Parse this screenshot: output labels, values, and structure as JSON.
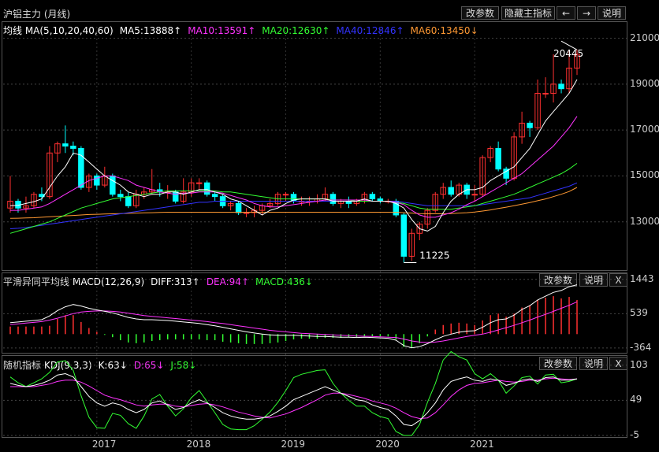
{
  "header": {
    "title": "沪铝主力 (月线)",
    "buttons": [
      "改参数",
      "隐藏主指标",
      "←",
      "→",
      "说明"
    ]
  },
  "ma_legend": [
    {
      "label": "均线 MA(5,10,20,40,60)",
      "color": "#ffffff"
    },
    {
      "label": "MA5:13888↑",
      "color": "#ffffff"
    },
    {
      "label": "MA10:13591↑",
      "color": "#ff33ff"
    },
    {
      "label": "MA20:12630↑",
      "color": "#33ff33"
    },
    {
      "label": "MA40:12846↑",
      "color": "#3333ff"
    },
    {
      "label": "MA60:13450↓",
      "color": "#ff9933"
    }
  ],
  "macd_panel": {
    "title": "平滑异同平均线",
    "legend": [
      {
        "label": "MACD(12,26,9)",
        "color": "#ffffff"
      },
      {
        "label": "DIFF:313↑",
        "color": "#ffffff"
      },
      {
        "label": "DEA:94↑",
        "color": "#ff33ff"
      },
      {
        "label": "MACD:436↓",
        "color": "#33ff33"
      }
    ],
    "buttons": [
      "改参数",
      "说明",
      "X"
    ],
    "yticks": [
      "1443",
      "539",
      "-364"
    ]
  },
  "kdj_panel": {
    "title": "随机指标",
    "legend": [
      {
        "label": "KDJ(9,3,3)",
        "color": "#ffffff"
      },
      {
        "label": "K:63↓",
        "color": "#ffffff"
      },
      {
        "label": "D:65↓",
        "color": "#ff33ff"
      },
      {
        "label": "J:58↓",
        "color": "#33ff33"
      }
    ],
    "buttons": [
      "改参数",
      "说明",
      "X"
    ],
    "yticks": [
      "103",
      "49",
      "-5"
    ]
  },
  "price_yticks": [
    "21000",
    "19000",
    "17000",
    "15000",
    "13000"
  ],
  "x_labels": [
    "2017",
    "2018",
    "2019",
    "2020",
    "2021"
  ],
  "annotations": {
    "high": "20445",
    "low": "11225"
  },
  "colors": {
    "up": "#ff3030",
    "down": "#00ffff",
    "ma5": "#ffffff",
    "ma10": "#ff33ff",
    "ma20": "#33ff33",
    "ma40": "#3333ff",
    "ma60": "#ff9933"
  },
  "chart_data": {
    "type": "candlestick",
    "price_range": [
      11000,
      21500
    ],
    "first_year": "2016",
    "candles": [
      [
        13600,
        13900,
        15000,
        13400
      ],
      [
        13900,
        13600,
        14000,
        13400
      ],
      [
        13600,
        13700,
        14100,
        13400
      ],
      [
        13700,
        14200,
        14300,
        13600
      ],
      [
        14200,
        14100,
        14500,
        13900
      ],
      [
        14100,
        16000,
        16300,
        14000
      ],
      [
        16000,
        16400,
        16500,
        15600
      ],
      [
        16400,
        16300,
        17200,
        16000
      ],
      [
        16300,
        16200,
        16500,
        15900
      ],
      [
        16200,
        14500,
        16300,
        14400
      ],
      [
        14500,
        15000,
        15100,
        14300
      ],
      [
        15000,
        14600,
        15100,
        14400
      ],
      [
        14600,
        15000,
        15400,
        14500
      ],
      [
        15000,
        14200,
        15100,
        14100
      ],
      [
        14200,
        14100,
        14400,
        13900
      ],
      [
        14100,
        13700,
        14300,
        13600
      ],
      [
        13700,
        14200,
        14400,
        13600
      ],
      [
        14200,
        14300,
        14500,
        14000
      ],
      [
        14300,
        14400,
        15300,
        14200
      ],
      [
        14400,
        14300,
        14700,
        14100
      ],
      [
        14300,
        14300,
        14600,
        14000
      ],
      [
        14300,
        13900,
        14400,
        13800
      ],
      [
        13900,
        14300,
        14900,
        13800
      ],
      [
        14300,
        14700,
        14900,
        14100
      ],
      [
        14700,
        14700,
        14900,
        14400
      ],
      [
        14700,
        14200,
        14800,
        14100
      ],
      [
        14200,
        14100,
        14300,
        13900
      ],
      [
        14100,
        13700,
        14200,
        13600
      ],
      [
        13700,
        13800,
        13900,
        13500
      ],
      [
        13800,
        13400,
        13900,
        13300
      ],
      [
        13400,
        13400,
        13600,
        13200
      ],
      [
        13400,
        13500,
        13700,
        13200
      ],
      [
        13500,
        13700,
        13800,
        13300
      ],
      [
        13700,
        13800,
        14000,
        13600
      ],
      [
        13800,
        14200,
        14300,
        13700
      ],
      [
        14200,
        14200,
        14300,
        13900
      ],
      [
        14200,
        13900,
        14300,
        13800
      ],
      [
        13900,
        13900,
        14100,
        13700
      ],
      [
        13900,
        13900,
        14100,
        13700
      ],
      [
        13900,
        14000,
        14200,
        13800
      ],
      [
        14000,
        14200,
        14500,
        13900
      ],
      [
        14200,
        13800,
        14300,
        13700
      ],
      [
        13800,
        13900,
        14000,
        13600
      ],
      [
        13900,
        13800,
        14100,
        13600
      ],
      [
        13800,
        13900,
        14000,
        13700
      ],
      [
        13900,
        14200,
        14300,
        13800
      ],
      [
        14200,
        14000,
        14300,
        13900
      ],
      [
        14000,
        13900,
        14100,
        13800
      ],
      [
        13900,
        13900,
        14000,
        13800
      ],
      [
        13900,
        13300,
        14000,
        13200
      ],
      [
        13300,
        11500,
        13400,
        11225
      ],
      [
        11500,
        12500,
        12700,
        11300
      ],
      [
        12500,
        12900,
        13000,
        12200
      ],
      [
        12900,
        13500,
        13600,
        12700
      ],
      [
        13500,
        14200,
        14300,
        13400
      ],
      [
        14200,
        14500,
        14700,
        14000
      ],
      [
        14500,
        14200,
        14800,
        14100
      ],
      [
        14200,
        14600,
        14700,
        14100
      ],
      [
        14600,
        14200,
        14700,
        14000
      ],
      [
        14200,
        14200,
        14600,
        13900
      ],
      [
        14200,
        15800,
        15900,
        14100
      ],
      [
        15800,
        16200,
        16300,
        15600
      ],
      [
        16200,
        15300,
        16500,
        15200
      ],
      [
        15300,
        14900,
        15400,
        14600
      ],
      [
        14900,
        16700,
        16900,
        14800
      ],
      [
        16700,
        17300,
        17800,
        16400
      ],
      [
        17300,
        17100,
        17400,
        16700
      ],
      [
        17100,
        18600,
        19200,
        17000
      ],
      [
        18600,
        18600,
        19300,
        18400
      ],
      [
        18600,
        19000,
        20300,
        18200
      ],
      [
        19000,
        18800,
        19200,
        18600
      ],
      [
        18800,
        19700,
        20445,
        18600
      ],
      [
        19700,
        20300,
        20500,
        19400
      ]
    ],
    "ma5": [
      13700,
      13720,
      13800,
      13880,
      14000,
      14500,
      15000,
      15400,
      16000,
      15900,
      15600,
      15300,
      15000,
      14800,
      14600,
      14300,
      14200,
      14100,
      14200,
      14200,
      14300,
      14300,
      14200,
      14300,
      14400,
      14400,
      14300,
      14200,
      14000,
      13900,
      13700,
      13500,
      13300,
      13500,
      13600,
      13800,
      13950,
      14000,
      14000,
      14000,
      14000,
      13900,
      13900,
      13900,
      13900,
      14000,
      13900,
      13900,
      13900,
      13800,
      13600,
      13100,
      12700,
      12600,
      12800,
      13400,
      13900,
      14200,
      14400,
      14400,
      14500,
      14800,
      15000,
      15200,
      15400,
      15800,
      16200,
      16800,
      17400,
      17800,
      18200,
      18600,
      19200
    ],
    "ma10": [
      13500,
      13500,
      13550,
      13600,
      13650,
      13800,
      14000,
      14200,
      14400,
      14600,
      14800,
      14900,
      15000,
      15000,
      14900,
      14800,
      14600,
      14500,
      14400,
      14300,
      14250,
      14200,
      14250,
      14250,
      14300,
      14300,
      14300,
      14250,
      14150,
      14050,
      13950,
      13800,
      13700,
      13650,
      13650,
      13700,
      13750,
      13800,
      13850,
      13900,
      13950,
      13950,
      13950,
      13950,
      13950,
      13950,
      13900,
      13900,
      13900,
      13850,
      13750,
      13500,
      13300,
      13200,
      13200,
      13300,
      13400,
      13550,
      13750,
      13900,
      14100,
      14300,
      14500,
      14700,
      14900,
      15100,
      15400,
      15700,
      16000,
      16300,
      16700,
      17100,
      17600
    ],
    "ma20": [
      12500,
      12600,
      12700,
      12800,
      12900,
      13000,
      13150,
      13300,
      13450,
      13600,
      13700,
      13800,
      13900,
      14000,
      14050,
      14100,
      14150,
      14200,
      14250,
      14300,
      14350,
      14350,
      14350,
      14350,
      14350,
      14350,
      14350,
      14300,
      14300,
      14250,
      14200,
      14150,
      14100,
      14050,
      14000,
      14000,
      14000,
      14000,
      14000,
      14000,
      14000,
      13950,
      13950,
      13950,
      13900,
      13900,
      13900,
      13900,
      13900,
      13850,
      13800,
      13700,
      13600,
      13550,
      13550,
      13550,
      13550,
      13600,
      13650,
      13700,
      13800,
      13900,
      14000,
      14100,
      14200,
      14350,
      14500,
      14650,
      14800,
      14950,
      15100,
      15300,
      15550
    ],
    "ma40": [
      12700,
      12720,
      12750,
      12800,
      12850,
      12900,
      12950,
      13000,
      13050,
      13100,
      13150,
      13200,
      13250,
      13300,
      13350,
      13400,
      13450,
      13500,
      13550,
      13600,
      13650,
      13700,
      13750,
      13800,
      13850,
      13850,
      13900,
      13900,
      13900,
      13900,
      13900,
      13900,
      13900,
      13900,
      13900,
      13900,
      13900,
      13900,
      13900,
      13900,
      13900,
      13900,
      13900,
      13900,
      13900,
      13900,
      13900,
      13900,
      13900,
      13900,
      13850,
      13800,
      13750,
      13700,
      13700,
      13700,
      13700,
      13700,
      13700,
      13700,
      13750,
      13800,
      13850,
      13900,
      13950,
      14000,
      14050,
      14150,
      14250,
      14350,
      14450,
      14550,
      14700
    ],
    "ma60": [
      13150,
      13160,
      13170,
      13180,
      13200,
      13220,
      13240,
      13260,
      13280,
      13300,
      13320,
      13330,
      13340,
      13350,
      13360,
      13370,
      13380,
      13390,
      13400,
      13410,
      13420,
      13420,
      13420,
      13420,
      13420,
      13420,
      13420,
      13420,
      13420,
      13420,
      13420,
      13420,
      13420,
      13420,
      13420,
      13420,
      13420,
      13420,
      13420,
      13420,
      13420,
      13420,
      13420,
      13420,
      13420,
      13420,
      13420,
      13420,
      13420,
      13420,
      13400,
      13380,
      13360,
      13350,
      13350,
      13350,
      13360,
      13380,
      13400,
      13430,
      13470,
      13520,
      13580,
      13640,
      13700,
      13770,
      13840,
      13920,
      14000,
      14100,
      14200,
      14320,
      14500
    ],
    "macd": {
      "range": [
        -450,
        1500
      ],
      "diff": [
        300,
        320,
        340,
        360,
        380,
        480,
        620,
        720,
        780,
        740,
        680,
        640,
        600,
        560,
        500,
        440,
        400,
        380,
        380,
        370,
        360,
        340,
        320,
        300,
        280,
        250,
        220,
        180,
        140,
        100,
        60,
        30,
        0,
        -20,
        -30,
        -30,
        -30,
        -40,
        -50,
        -60,
        -60,
        -70,
        -80,
        -80,
        -90,
        -80,
        -90,
        -100,
        -110,
        -160,
        -300,
        -360,
        -330,
        -250,
        -150,
        -60,
        0,
        50,
        80,
        90,
        180,
        300,
        380,
        400,
        500,
        650,
        750,
        900,
        1000,
        1100,
        1150,
        1250,
        1300
      ],
      "dea": [
        250,
        270,
        290,
        310,
        330,
        370,
        420,
        480,
        540,
        580,
        600,
        610,
        610,
        600,
        580,
        550,
        520,
        490,
        470,
        450,
        430,
        410,
        390,
        370,
        350,
        330,
        300,
        280,
        250,
        220,
        190,
        160,
        130,
        100,
        80,
        60,
        40,
        20,
        10,
        0,
        -10,
        -20,
        -30,
        -40,
        -50,
        -55,
        -60,
        -70,
        -80,
        -90,
        -130,
        -180,
        -210,
        -220,
        -210,
        -180,
        -140,
        -100,
        -60,
        -30,
        0,
        50,
        110,
        170,
        230,
        300,
        370,
        450,
        520,
        600,
        680,
        760,
        850
      ],
      "hist": [
        200,
        200,
        200,
        200,
        200,
        220,
        400,
        500,
        500,
        320,
        160,
        60,
        -20,
        -80,
        -160,
        -220,
        -240,
        -220,
        -180,
        -160,
        -140,
        -140,
        -140,
        -140,
        -140,
        -160,
        -160,
        -200,
        -220,
        -240,
        -260,
        -260,
        -260,
        -240,
        -220,
        -180,
        -140,
        -120,
        -120,
        -120,
        -100,
        -100,
        -100,
        -80,
        -80,
        -50,
        -60,
        -60,
        -60,
        -140,
        -340,
        -360,
        -240,
        -60,
        120,
        240,
        280,
        300,
        280,
        240,
        360,
        500,
        540,
        460,
        540,
        700,
        760,
        900,
        960,
        1000,
        940,
        980,
        900
      ]
    },
    "kdj": {
      "range": [
        -5,
        110
      ],
      "k": [
        75,
        72,
        70,
        72,
        75,
        80,
        88,
        90,
        85,
        70,
        55,
        45,
        40,
        45,
        42,
        35,
        30,
        35,
        45,
        48,
        42,
        35,
        38,
        45,
        50,
        45,
        38,
        30,
        25,
        22,
        20,
        20,
        22,
        25,
        32,
        40,
        50,
        55,
        60,
        65,
        70,
        65,
        60,
        55,
        50,
        48,
        42,
        38,
        35,
        25,
        12,
        10,
        18,
        30,
        45,
        65,
        78,
        82,
        85,
        80,
        78,
        82,
        80,
        72,
        75,
        80,
        82,
        78,
        84,
        85,
        80,
        80,
        82
      ],
      "d": [
        70,
        70,
        70,
        70,
        72,
        74,
        78,
        80,
        80,
        77,
        71,
        64,
        57,
        53,
        50,
        46,
        42,
        40,
        42,
        43,
        43,
        40,
        39,
        41,
        43,
        44,
        42,
        39,
        35,
        31,
        28,
        25,
        23,
        22,
        25,
        28,
        33,
        38,
        44,
        50,
        57,
        60,
        60,
        58,
        55,
        52,
        48,
        45,
        42,
        37,
        30,
        24,
        21,
        22,
        30,
        42,
        55,
        65,
        72,
        75,
        76,
        78,
        80,
        78,
        77,
        78,
        80,
        80,
        82,
        83,
        82,
        81,
        82
      ],
      "j": [
        85,
        76,
        70,
        76,
        82,
        92,
        108,
        110,
        95,
        56,
        23,
        7,
        6,
        29,
        26,
        13,
        6,
        25,
        51,
        58,
        40,
        25,
        36,
        53,
        64,
        47,
        30,
        12,
        5,
        4,
        4,
        10,
        20,
        31,
        46,
        64,
        84,
        89,
        92,
        95,
        96,
        75,
        60,
        49,
        40,
        40,
        30,
        24,
        21,
        1,
        -5,
        -5,
        12,
        46,
        75,
        111,
        124,
        116,
        111,
        90,
        82,
        90,
        80,
        60,
        71,
        84,
        86,
        74,
        88,
        89,
        76,
        78,
        82
      ]
    }
  }
}
